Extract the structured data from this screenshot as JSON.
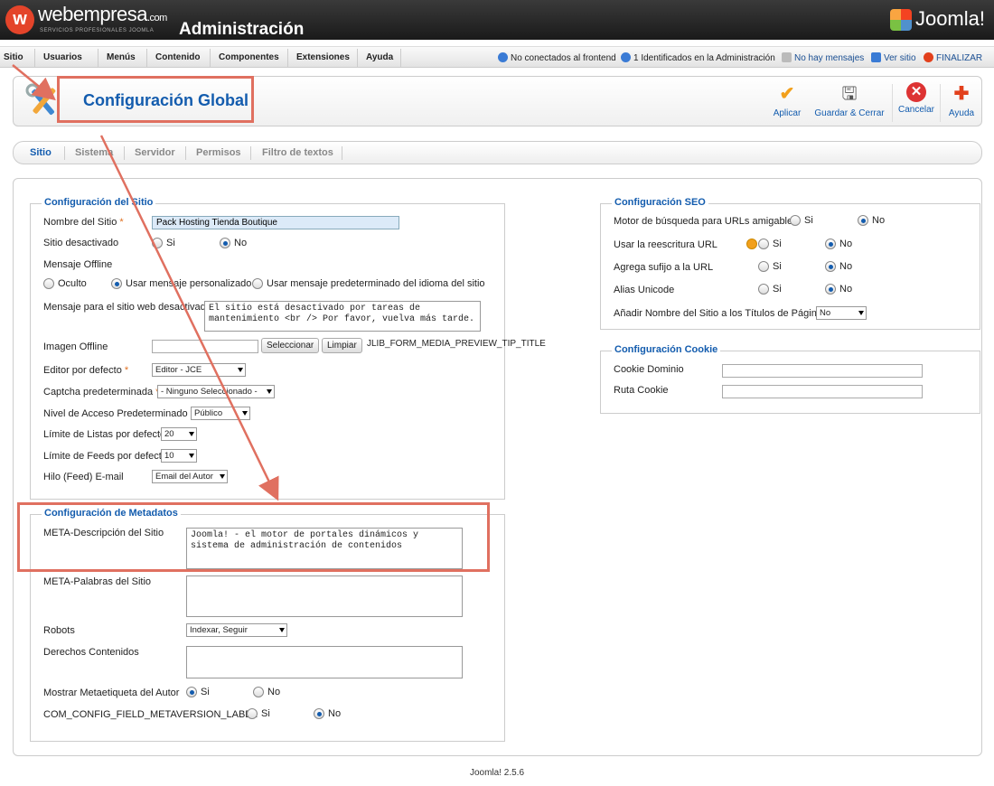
{
  "header": {
    "brand": "webempresa",
    "brand_suffix": ".com",
    "brand_sub": "SERVICIOS PROFESIONALES JOOMLA",
    "title": "Administración",
    "product": "Joomla!"
  },
  "menu": {
    "items": [
      "Sitio",
      "Usuarios",
      "Menús",
      "Contenido",
      "Componentes",
      "Extensiones",
      "Ayuda"
    ],
    "status": {
      "frontend": "No conectados al frontend",
      "admin": "1 Identificados en la Administración",
      "messages": "No hay mensajes",
      "view_site": "Ver sitio",
      "logout": "FINALIZAR"
    }
  },
  "toolbar": {
    "page_title": "Configuración Global",
    "apply": "Aplicar",
    "save_close": "Guardar & Cerrar",
    "cancel": "Cancelar",
    "help": "Ayuda"
  },
  "tabs": [
    "Sitio",
    "Sistema",
    "Servidor",
    "Permisos",
    "Filtro de textos"
  ],
  "site": {
    "legend": "Configuración del Sitio",
    "site_name_label": "Nombre del Sitio",
    "site_name_value": "Pack Hosting Tienda Boutique",
    "offline_label": "Sitio desactivado",
    "yes": "Si",
    "no": "No",
    "offline_msg_label": "Mensaje Offline",
    "opt_hidden": "Oculto",
    "opt_custom": "Usar mensaje personalizado",
    "opt_default": "Usar mensaje predeterminado del idioma del sitio",
    "offline_text_label": "Mensaje para el sitio web desactivado",
    "offline_text_value": "El sitio está desactivado por tareas de mantenimiento <br /> Por favor, vuelva más tarde.",
    "offline_image_label": "Imagen Offline",
    "select_btn": "Seleccionar",
    "clear_btn": "Limpiar",
    "preview_tip": "JLIB_FORM_MEDIA_PREVIEW_TIP_TITLE",
    "editor_label": "Editor por defecto",
    "editor_value": "Editor - JCE",
    "captcha_label": "Captcha predeterminada",
    "captcha_value": "- Ninguno Seleccionado -",
    "access_label": "Nivel de Acceso Predeterminado",
    "access_value": "Público",
    "list_limit_label": "Límite de Listas por defecto",
    "list_limit_value": "20",
    "feed_limit_label": "Límite de Feeds por defecto",
    "feed_limit_value": "10",
    "feed_email_label": "Hilo (Feed) E-mail",
    "feed_email_value": "Email del Autor"
  },
  "meta": {
    "legend": "Configuración de Metadatos",
    "desc_label": "META-Descripción del Sitio",
    "desc_value": "Joomla! - el motor de portales dinámicos y sistema de administración de contenidos",
    "keywords_label": "META-Palabras del Sitio",
    "robots_label": "Robots",
    "robots_value": "Indexar, Seguir",
    "rights_label": "Derechos Contenidos",
    "author_label": "Mostrar Metaetiqueta del Autor",
    "version_label": "COM_CONFIG_FIELD_METAVERSION_LABEL"
  },
  "seo": {
    "legend": "Configuración SEO",
    "sef_label": "Motor de búsqueda para URLs amigables",
    "rewrite_label": "Usar la reescritura URL",
    "suffix_label": "Agrega sufijo a la URL",
    "unicode_label": "Alias Unicode",
    "sitename_label": "Añadir Nombre del Sitio a los Títulos de Páginas",
    "sitename_value": "No"
  },
  "cookie": {
    "legend": "Configuración Cookie",
    "domain_label": "Cookie Dominio",
    "path_label": "Ruta Cookie"
  },
  "footer": "Joomla! 2.5.6",
  "colors": {
    "accent": "#135cae",
    "highlight": "#e07060",
    "required": "#e07020"
  }
}
